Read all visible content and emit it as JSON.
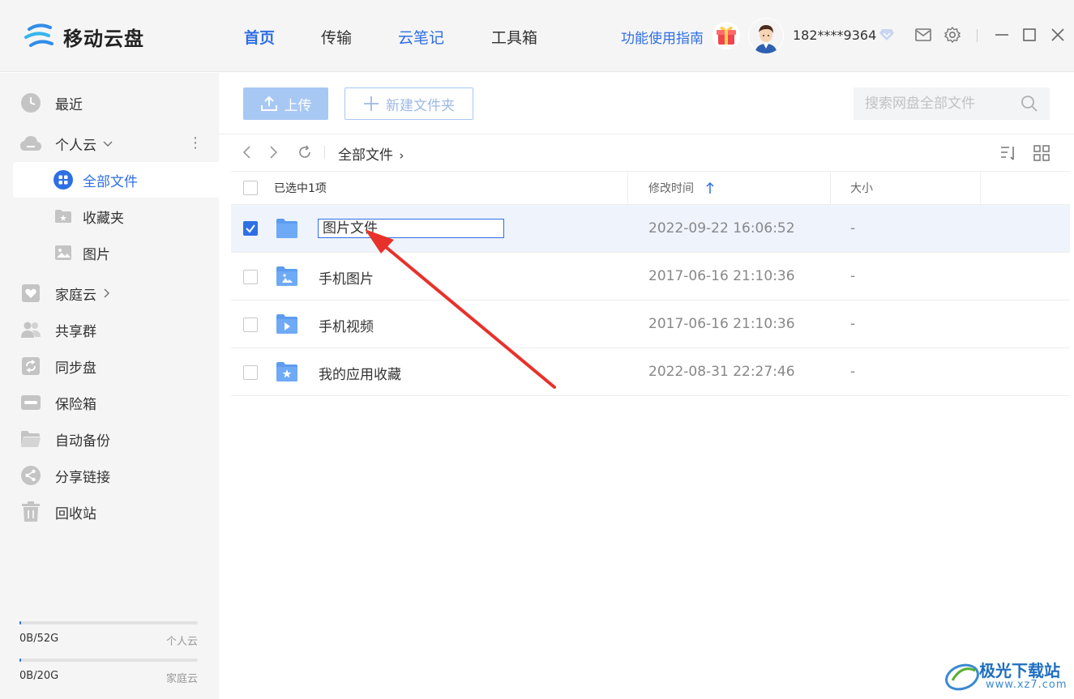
{
  "app": {
    "name": "移动云盘"
  },
  "topnav": [
    {
      "label": "首页"
    },
    {
      "label": "传输"
    },
    {
      "label": "云笔记"
    },
    {
      "label": "工具箱"
    }
  ],
  "header": {
    "guide": "功能使用指南",
    "phone": "182****9364"
  },
  "sidebar": {
    "recent": "最近",
    "personal_cloud": "个人云",
    "all_files": "全部文件",
    "favorites": "收藏夹",
    "pictures": "图片",
    "family_cloud": "家庭云",
    "share_group": "共享群",
    "sync_disk": "同步盘",
    "safe_box": "保险箱",
    "auto_backup": "自动备份",
    "share_link": "分享链接",
    "recycle_bin": "回收站",
    "quota_personal": {
      "used": "0B/52G",
      "label": "个人云",
      "fraction": 0.01
    },
    "quota_family": {
      "used": "0B/20G",
      "label": "家庭云",
      "fraction": 0.01
    }
  },
  "toolbar": {
    "upload": "上传",
    "new_folder": "新建文件夹",
    "search_placeholder": "搜索网盘全部文件"
  },
  "breadcrumb": {
    "current": "全部文件"
  },
  "table": {
    "selected_label": "已选中1项",
    "col_modified": "修改时间",
    "col_size": "大小",
    "rows": [
      {
        "name": "图片文件",
        "modified": "2022-09-22 16:06:52",
        "size": "-",
        "checked": true,
        "editing": true
      },
      {
        "name": "手机图片",
        "modified": "2017-06-16 21:10:36",
        "size": "-",
        "checked": false
      },
      {
        "name": "手机视频",
        "modified": "2017-06-16 21:10:36",
        "size": "-",
        "checked": false
      },
      {
        "name": "我的应用收藏",
        "modified": "2022-08-31 22:27:46",
        "size": "-",
        "checked": false
      }
    ]
  },
  "watermark": {
    "text": "极光下载站",
    "url": "www.xz7.com"
  },
  "colors": {
    "accent": "#2f6fe4",
    "annotation": "#e8312a"
  }
}
